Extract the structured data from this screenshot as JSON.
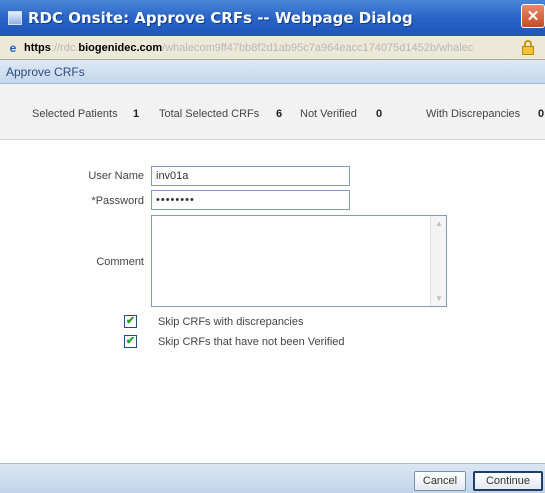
{
  "window": {
    "title": "RDC Onsite: Approve CRFs -- Webpage Dialog",
    "close_glyph": "✕"
  },
  "address": {
    "protocol": "https",
    "prefix": "://rdc.",
    "domain": "biogenidec.com",
    "path": "/whalecom9ff47bb8f2d1ab95c7a964eacc174075d1452b/whalec"
  },
  "panel": {
    "title": "Approve CRFs"
  },
  "stats": {
    "selected_patients_label": "Selected Patients",
    "selected_patients_value": "1",
    "total_crfs_label": "Total Selected CRFs",
    "total_crfs_value": "6",
    "not_verified_label": "Not Verified",
    "not_verified_value": "0",
    "with_discrepancies_label": "With Discrepancies",
    "with_discrepancies_value": "0"
  },
  "form": {
    "username_label": "User Name",
    "username_value": "inv01a",
    "password_label": "*Password",
    "password_value": "••••••••",
    "comment_label": "Comment",
    "comment_value": ""
  },
  "options": {
    "skip_discrepancies_label": "Skip CRFs with discrepancies",
    "skip_discrepancies_checked": true,
    "skip_unverified_label": "Skip CRFs that have not been Verified",
    "skip_unverified_checked": true,
    "check_glyph": "✔"
  },
  "buttons": {
    "cancel": "Cancel",
    "continue": "Continue"
  }
}
